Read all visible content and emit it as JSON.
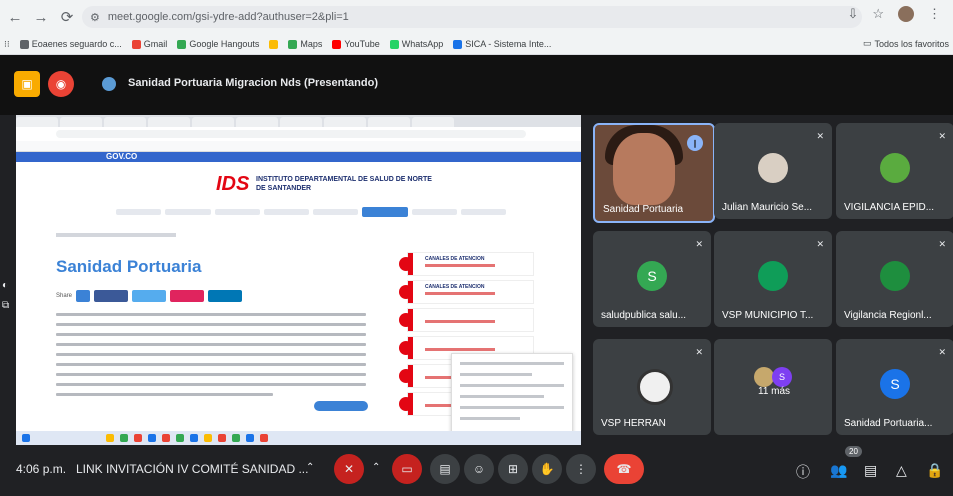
{
  "browser": {
    "url": "meet.google.com/gsi-ydre-add?authuser=2&pli=1",
    "bookmarks": [
      {
        "label": "Eoaenes seguardo c...",
        "color": "#5f6368"
      },
      {
        "label": "Gmail",
        "color": "#ea4335"
      },
      {
        "label": "Google Hangouts",
        "color": "#34a853"
      },
      {
        "label": "",
        "color": "#fbbc04"
      },
      {
        "label": "Maps",
        "color": "#34a853"
      },
      {
        "label": "YouTube",
        "color": "#ff0000"
      },
      {
        "label": "WhatsApp",
        "color": "#25d366"
      },
      {
        "label": "SICA - Sistema Inte...",
        "color": "#1a73e8"
      }
    ],
    "all_bookmarks_label": "Todos los favoritos"
  },
  "meet": {
    "presenting_title": "Sanidad Portuaria Migracion Nds (Presentando)",
    "time": "4:06 p.m.",
    "meeting_name": "LINK INVITACIÓN IV COMITÉ SANIDAD ...",
    "participant_count": "20",
    "tiles": [
      {
        "name": "Sanidad Portuaria",
        "avatar": "",
        "color": "#b77a5e",
        "self": true
      },
      {
        "name": "Julian Mauricio Se...",
        "avatar": "",
        "color": "#d9cfc3"
      },
      {
        "name": "VIGILANCIA EPID...",
        "avatar": "",
        "color": "#5aab3f"
      },
      {
        "name": "saludpublica salu...",
        "avatar": "S",
        "color": "#34a853"
      },
      {
        "name": "VSP MUNICIPIO T...",
        "avatar": "",
        "color": "#0f9d58"
      },
      {
        "name": "Vigilancia Regionl...",
        "avatar": "",
        "color": "#1e8e3e"
      },
      {
        "name": "VSP HERRAN",
        "avatar": "",
        "color": "#f0f0f0"
      },
      {
        "name": "11 más",
        "avatar": "",
        "color": "#5f6368"
      },
      {
        "name": "Sanidad Portuaria...",
        "avatar": "S",
        "color": "#1a73e8"
      }
    ]
  },
  "shared_screen": {
    "govco": "GOV.CO",
    "logo": "IDS",
    "institute": "INSTITUTO DEPARTAMENTAL DE SALUD DE NORTE DE SANTANDER",
    "heading": "Sanidad Portuaria",
    "share_label": "Share",
    "side_cards": [
      "CANALES DE ATENCION",
      "CANALES DE ATENCION",
      "",
      "",
      "",
      ""
    ]
  },
  "colors": {
    "accent": "#8ab4f8",
    "hangup": "#ea4335"
  }
}
